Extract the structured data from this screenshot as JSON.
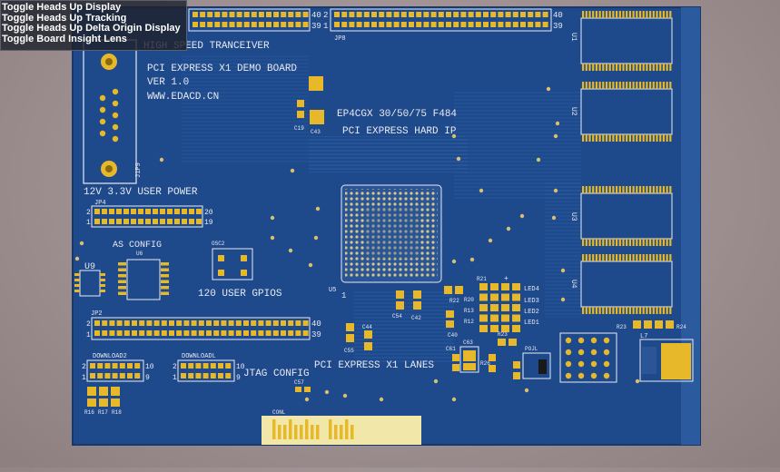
{
  "menu": {
    "items": [
      {
        "label": "Toggle Heads Up Display"
      },
      {
        "label": "Toggle Heads Up Tracking"
      },
      {
        "label": "Toggle Heads Up Delta Origin Display"
      },
      {
        "label": "Toggle Board Insight Lens"
      }
    ]
  },
  "board": {
    "title_line1": "PCI EXPRESS X1 DEMO BOARD",
    "title_line2": "VER 1.0",
    "title_line3": "WWW.EDACD.CN",
    "tranceiver": "HIGH SPEED TRANCEIVER",
    "fpga": "EP4CGX 30/50/75  F484",
    "hard_ip": "PCI EXPRESS HARD IP",
    "power": "12V 3.3V USER POWER",
    "as_config": "AS CONFIG",
    "user_gpios": "120 USER GPIOS",
    "lanes": "PCI EXPRESS X1 LANES",
    "jtag": "JTAG CONFIG",
    "download": "DOWNLOADL",
    "download2": "DOWNLOAD2",
    "osc": "OSC2",
    "pcie_conn": "CONL"
  },
  "refdes": {
    "jp8": "JP8",
    "jp4": "JP4",
    "jp2": "JP2",
    "u9": "U9",
    "u6": "U6",
    "u5": "U5",
    "c19": "C19",
    "c43": "C43",
    "c54": "C54",
    "c42": "C42",
    "c40": "C40",
    "c55": "C55",
    "c44": "C44",
    "c61": "C61",
    "c63": "C63",
    "c57": "C57",
    "r21": "R21",
    "r22": "R22",
    "r20": "R20",
    "r13": "R13",
    "r12": "R12",
    "r23": "R23",
    "r26": "R26",
    "r16": "R16",
    "r17": "R17",
    "r18": "R18",
    "led4": "LED4",
    "led3": "LED3",
    "led2": "LED2",
    "led1": "LED1",
    "r23b": "R23",
    "r24": "R24",
    "l7": "L7",
    "u1": "U1",
    "u2": "U2",
    "u3": "U3",
    "u4": "U4",
    "power_ref": "POJL",
    "conn_ref": "J1P9",
    "plus": "+"
  },
  "pins": {
    "p40": "40",
    "p39": "39",
    "p2": "2",
    "p1": "1",
    "p20": "20",
    "p19": "19",
    "p10": "10",
    "p9": "9"
  },
  "colors": {
    "pcb": "#1e4a8c",
    "copper": "#e7b82a",
    "silk": "#e9e9f0",
    "gold_finger": "#f1e7a8"
  }
}
